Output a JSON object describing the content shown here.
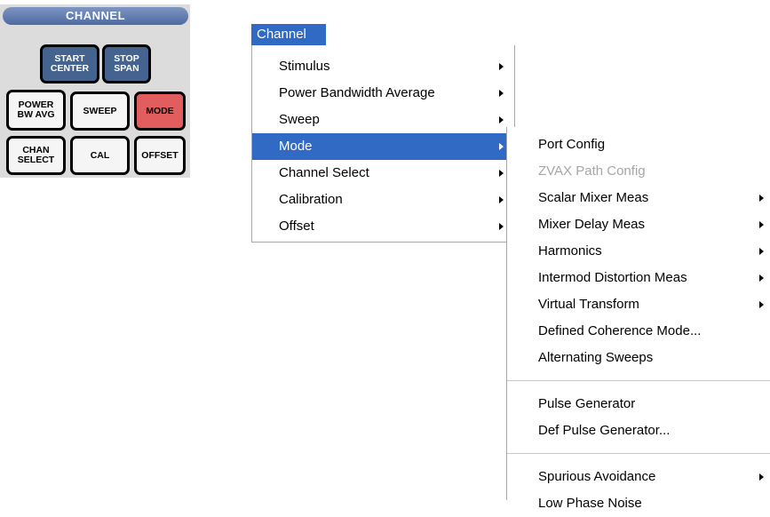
{
  "hardkeys": {
    "title": "CHANNEL",
    "start_center": "START\nCENTER",
    "stop_span": "STOP\nSPAN",
    "power_bw_avg": "POWER\nBW AVG",
    "sweep": "SWEEP",
    "mode": "MODE",
    "chan_select": "CHAN\nSELECT",
    "cal": "CAL",
    "offset": "OFFSET"
  },
  "menubar": {
    "channel": "Channel"
  },
  "channel_menu": {
    "items": [
      {
        "label": "Stimulus"
      },
      {
        "label": "Power Bandwidth Average"
      },
      {
        "label": "Sweep"
      },
      {
        "label": "Mode"
      },
      {
        "label": "Channel Select"
      },
      {
        "label": "Calibration"
      },
      {
        "label": "Offset"
      }
    ]
  },
  "mode_submenu": {
    "items": [
      {
        "label": "Port Config"
      },
      {
        "label": "ZVAX Path Config"
      },
      {
        "label": "Scalar Mixer Meas"
      },
      {
        "label": "Mixer Delay Meas"
      },
      {
        "label": "Harmonics"
      },
      {
        "label": "Intermod Distortion Meas"
      },
      {
        "label": "Virtual Transform"
      },
      {
        "label": "Defined Coherence Mode..."
      },
      {
        "label": "Alternating Sweeps"
      },
      {
        "label": "Pulse Generator"
      },
      {
        "label": "Def Pulse Generator..."
      },
      {
        "label": "Spurious Avoidance"
      },
      {
        "label": "Low Phase Noise"
      }
    ]
  },
  "colors": {
    "selection": "#316ac5",
    "mode_key": "#e25e5e",
    "blue_key": "#44648f",
    "disabled_text": "#a6a6a6"
  }
}
